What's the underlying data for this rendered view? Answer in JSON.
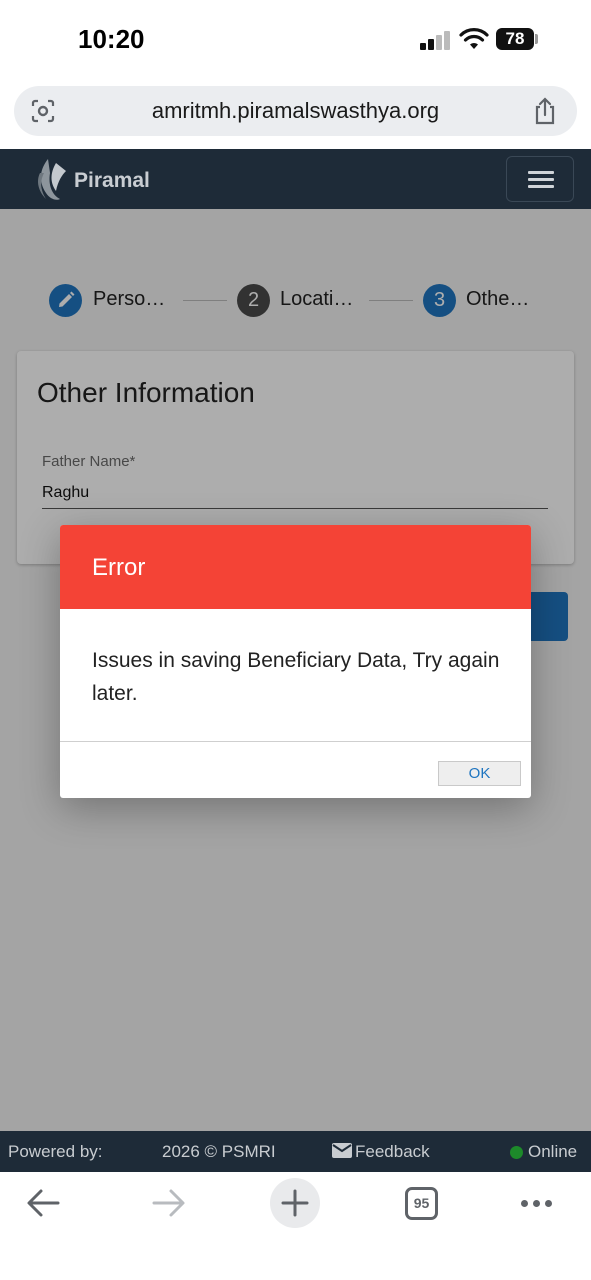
{
  "status_bar": {
    "time": "10:20",
    "battery": "78"
  },
  "browser": {
    "url": "amritmh.piramalswasthya.org"
  },
  "navbar": {
    "brand": "Piramal"
  },
  "stepper": {
    "steps": [
      {
        "number": "",
        "label": "Perso…",
        "state": "edit",
        "color": "#1f75c0"
      },
      {
        "number": "2",
        "label": "Locati…",
        "state": "inactive",
        "color": "#4a4a4a"
      },
      {
        "number": "3",
        "label": "Othe…",
        "state": "active",
        "color": "#1f75c0"
      }
    ]
  },
  "form": {
    "title": "Other Information",
    "father_name_label": "Father Name*",
    "father_name_value": "Raghu"
  },
  "dialog": {
    "title": "Error",
    "message": "Issues in saving Beneficiary Data, Try again later.",
    "ok_label": "OK",
    "header_color": "#f44336"
  },
  "footer": {
    "powered_by": "Powered by:",
    "copyright": "2026 © PSMRI",
    "feedback": "Feedback",
    "status": "Online"
  },
  "toolbar": {
    "tab_count": "95"
  },
  "colors": {
    "primary": "#1f75c0",
    "navbar": "#1e2b38",
    "error": "#f44336",
    "online": "#1d8a2a"
  }
}
